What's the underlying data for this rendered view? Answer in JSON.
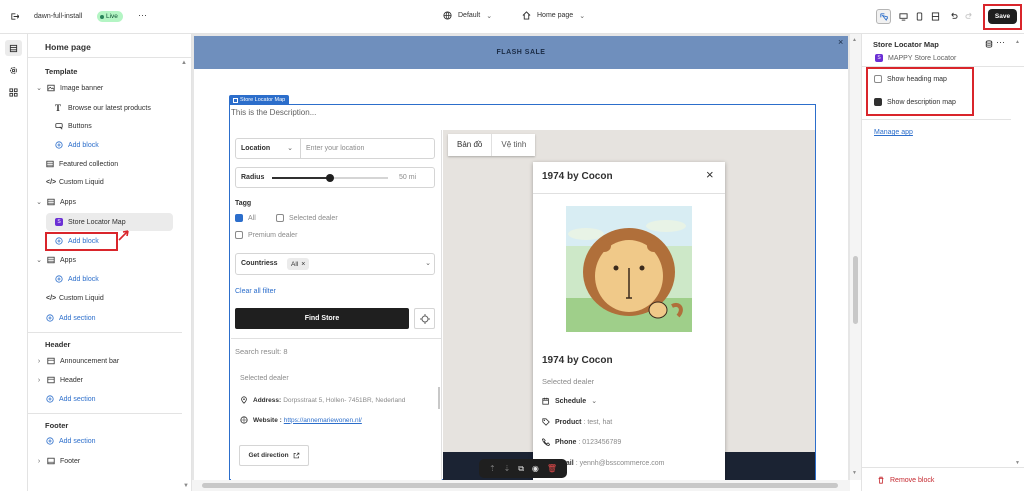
{
  "topbar": {
    "store_name": "dawn-full-install",
    "live_badge": "Live",
    "more": "···",
    "theme_select": "Default",
    "page_select": "Home page",
    "save_label": "Save"
  },
  "left_panel": {
    "title": "Home page",
    "template_header": "Template",
    "items": {
      "image_banner": "Image banner",
      "browse_products": "Browse our latest products",
      "buttons": "Buttons",
      "add_block_1": "Add block",
      "featured_collection": "Featured collection",
      "custom_liquid_1": "Custom Liquid",
      "apps_1": "Apps",
      "store_locator_map": "Store Locator Map",
      "add_block_2": "Add block",
      "apps_2": "Apps",
      "add_block_3": "Add block",
      "custom_liquid_2": "Custom Liquid",
      "add_section_1": "Add section"
    },
    "header_header": "Header",
    "header_items": {
      "announcement_bar": "Announcement bar",
      "header": "Header",
      "add_section": "Add section"
    },
    "footer_header": "Footer",
    "footer_items": {
      "add_section": "Add section",
      "footer": "Footer"
    }
  },
  "preview": {
    "flash_sale": "FLASH SALE",
    "block_tag": "Store Locator Map",
    "description": "This is the Description...",
    "location_label": "Location",
    "location_placeholder": "Enter your location",
    "radius_label": "Radius",
    "radius_value": "50 mi",
    "radius_fraction": 0.5,
    "tagg_label": "Tagg",
    "tag_all": "All",
    "tag_selected": "Selected dealer",
    "tag_premium": "Premium dealer",
    "countries_label": "Countriess",
    "countries_chip": "All",
    "clear_filter": "Clear all filter",
    "find_store": "Find Store",
    "search_result": "Search result: 8",
    "result_tag": "Selected dealer",
    "address_label": "Address:",
    "address_value": "Dorpsstraat 5, Hollen- 7451BR, Nederland",
    "website_label": "Website :",
    "website_value": "https://annemariewonen.nl/",
    "get_direction": "Get direction",
    "map_tab_1": "Bản đồ",
    "map_tab_2": "Vệ tinh",
    "popup_title": "1974 by Cocon",
    "popup_name": "1974 by Cocon",
    "popup_tag": "Selected dealer",
    "schedule_label": "Schedule",
    "product_label": "Product",
    "product_value": ": test, hat",
    "phone_label": "Phone",
    "phone_value": ": 0123456789",
    "email_label": "Email",
    "email_value": ": yennh@bsscommerce.com"
  },
  "right_panel": {
    "title": "Store Locator Map",
    "app_name": "MAPPY Store Locator",
    "show_heading": "Show heading map",
    "show_heading_checked": false,
    "show_description": "Show description map",
    "show_description_checked": true,
    "manage_app": "Manage app",
    "remove_block": "Remove block"
  },
  "colors": {
    "flash_bar": "#6f8fbd",
    "accent_blue": "#2c6ecb",
    "highlight_red": "#d9252b",
    "live_green": "#b4f5c4",
    "app_purple": "#6b2fd4",
    "dark_button": "#1f1f1f"
  }
}
